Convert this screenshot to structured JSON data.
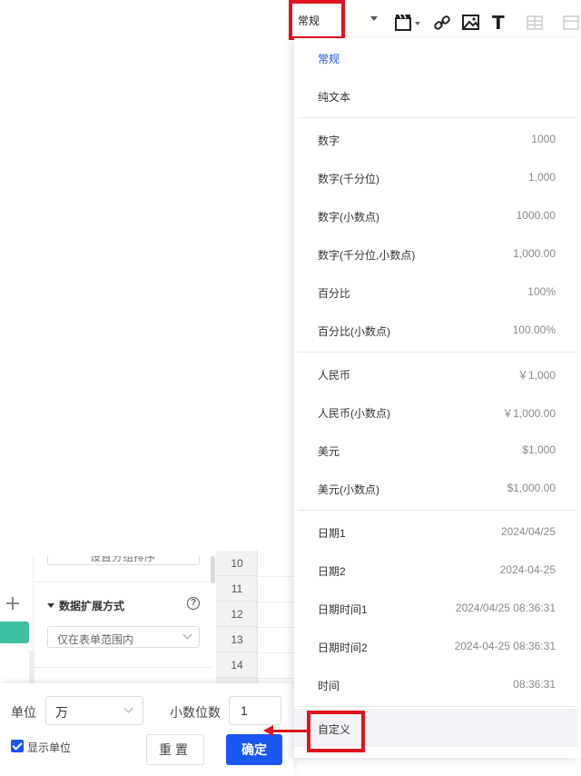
{
  "toolbar": {
    "format_value": "常规",
    "bold_t": "T"
  },
  "menu": {
    "groups": [
      [
        {
          "label": "常规",
          "example": ""
        },
        {
          "label": "纯文本",
          "example": ""
        }
      ],
      [
        {
          "label": "数字",
          "example": "1000"
        },
        {
          "label": "数字(千分位)",
          "example": "1,000"
        },
        {
          "label": "数字(小数点)",
          "example": "1000.00"
        },
        {
          "label": "数字(千分位,小数点)",
          "example": "1,000.00"
        },
        {
          "label": "百分比",
          "example": "100%"
        },
        {
          "label": "百分比(小数点)",
          "example": "100.00%"
        }
      ],
      [
        {
          "label": "人民币",
          "example": "￥1,000"
        },
        {
          "label": "人民币(小数点)",
          "example": "￥1,000.00"
        },
        {
          "label": "美元",
          "example": "$1,000"
        },
        {
          "label": "美元(小数点)",
          "example": "$1,000.00"
        }
      ],
      [
        {
          "label": "日期1",
          "example": "2024/04/25"
        },
        {
          "label": "日期2",
          "example": "2024-04-25"
        },
        {
          "label": "日期时间1",
          "example": "2024/04/25 08:36:31"
        },
        {
          "label": "日期时间2",
          "example": "2024-04-25 08:36:31"
        },
        {
          "label": "时间",
          "example": "08:36:31"
        }
      ],
      [
        {
          "label": "自定义",
          "example": ""
        }
      ]
    ]
  },
  "left_panel": {
    "top_button": "设置分组排序",
    "section_title": "数据扩展方式",
    "help": "?",
    "expand_value": "仅在表单范围内"
  },
  "rows": [
    "10",
    "11",
    "12",
    "13",
    "14"
  ],
  "unit_dialog": {
    "unit_label": "单位",
    "unit_value": "万",
    "decimal_label": "小数位数",
    "decimal_value": "1",
    "show_unit_label": "显示单位",
    "show_unit_checked": true,
    "reset_label": "重置",
    "ok_label": "确定"
  },
  "colors": {
    "accent": "#1a56f0",
    "highlight": "#e0141e",
    "teal": "#3cc0a0"
  }
}
